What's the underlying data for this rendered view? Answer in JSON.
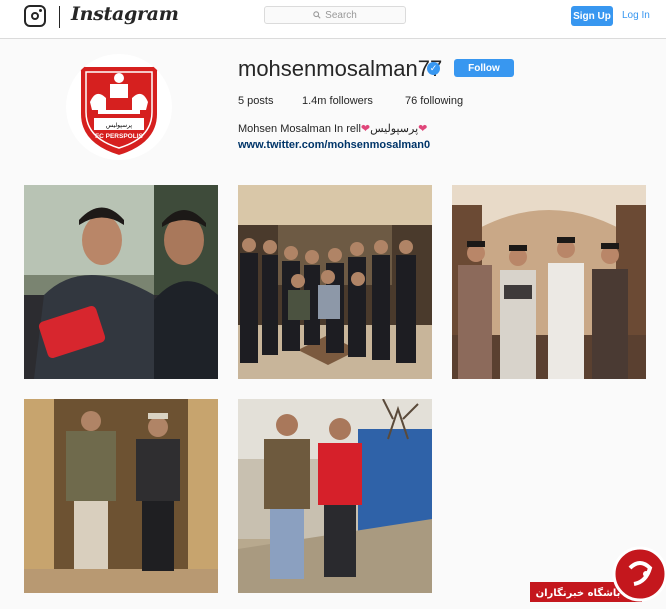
{
  "header": {
    "brand": "Instagram",
    "search_placeholder": "Search",
    "signup_label": "Sign Up",
    "login_label": "Log In"
  },
  "profile": {
    "username": "mohsenmosalman77",
    "verified": true,
    "follow_label": "Follow",
    "posts": "5 posts",
    "followers": "1.4m followers",
    "following": "76 following",
    "bio_name": "Mohsen Mosalman In rell",
    "bio_persian": "پرسپولیس",
    "website": "www.twitter.com/mohsenmosalman0",
    "avatar_logo_text": "FC PERSPOLIS"
  },
  "posts": [
    {
      "description": "selfie with red phone"
    },
    {
      "description": "group photo"
    },
    {
      "description": "four men standing"
    },
    {
      "description": "mirror selfie in elevator"
    },
    {
      "description": "two men walking outdoors"
    }
  ],
  "watermark": {
    "text": "باشگاه خبرنگاران"
  },
  "colors": {
    "accent": "#3897f0",
    "link": "#003569",
    "brand_red": "#d6201f"
  }
}
